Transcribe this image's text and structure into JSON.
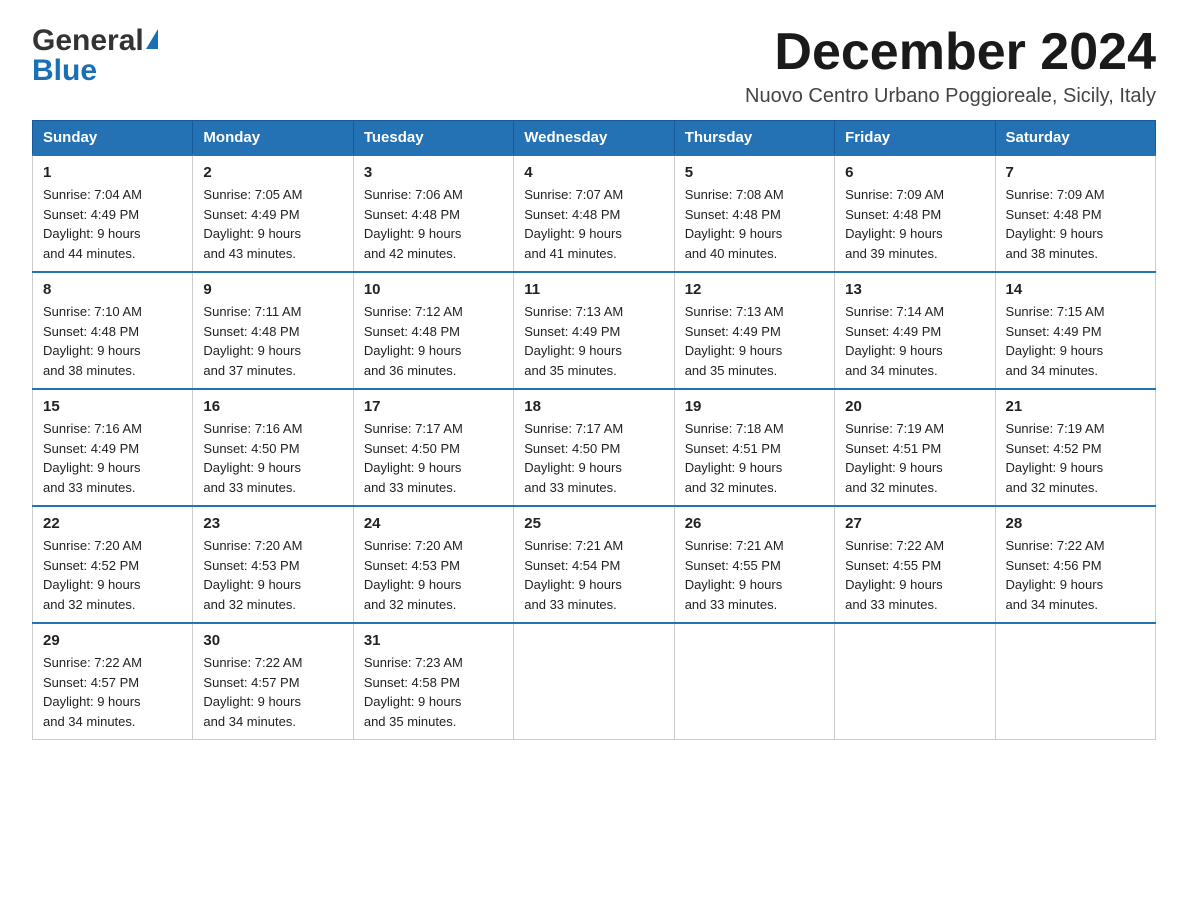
{
  "logo": {
    "general": "General",
    "triangle": "▶",
    "blue": "Blue"
  },
  "header": {
    "month": "December 2024",
    "location": "Nuovo Centro Urbano Poggioreale, Sicily, Italy"
  },
  "days_of_week": [
    "Sunday",
    "Monday",
    "Tuesday",
    "Wednesday",
    "Thursday",
    "Friday",
    "Saturday"
  ],
  "weeks": [
    [
      {
        "day": "1",
        "sunrise": "7:04 AM",
        "sunset": "4:49 PM",
        "daylight": "9 hours and 44 minutes."
      },
      {
        "day": "2",
        "sunrise": "7:05 AM",
        "sunset": "4:49 PM",
        "daylight": "9 hours and 43 minutes."
      },
      {
        "day": "3",
        "sunrise": "7:06 AM",
        "sunset": "4:48 PM",
        "daylight": "9 hours and 42 minutes."
      },
      {
        "day": "4",
        "sunrise": "7:07 AM",
        "sunset": "4:48 PM",
        "daylight": "9 hours and 41 minutes."
      },
      {
        "day": "5",
        "sunrise": "7:08 AM",
        "sunset": "4:48 PM",
        "daylight": "9 hours and 40 minutes."
      },
      {
        "day": "6",
        "sunrise": "7:09 AM",
        "sunset": "4:48 PM",
        "daylight": "9 hours and 39 minutes."
      },
      {
        "day": "7",
        "sunrise": "7:09 AM",
        "sunset": "4:48 PM",
        "daylight": "9 hours and 38 minutes."
      }
    ],
    [
      {
        "day": "8",
        "sunrise": "7:10 AM",
        "sunset": "4:48 PM",
        "daylight": "9 hours and 38 minutes."
      },
      {
        "day": "9",
        "sunrise": "7:11 AM",
        "sunset": "4:48 PM",
        "daylight": "9 hours and 37 minutes."
      },
      {
        "day": "10",
        "sunrise": "7:12 AM",
        "sunset": "4:48 PM",
        "daylight": "9 hours and 36 minutes."
      },
      {
        "day": "11",
        "sunrise": "7:13 AM",
        "sunset": "4:49 PM",
        "daylight": "9 hours and 35 minutes."
      },
      {
        "day": "12",
        "sunrise": "7:13 AM",
        "sunset": "4:49 PM",
        "daylight": "9 hours and 35 minutes."
      },
      {
        "day": "13",
        "sunrise": "7:14 AM",
        "sunset": "4:49 PM",
        "daylight": "9 hours and 34 minutes."
      },
      {
        "day": "14",
        "sunrise": "7:15 AM",
        "sunset": "4:49 PM",
        "daylight": "9 hours and 34 minutes."
      }
    ],
    [
      {
        "day": "15",
        "sunrise": "7:16 AM",
        "sunset": "4:49 PM",
        "daylight": "9 hours and 33 minutes."
      },
      {
        "day": "16",
        "sunrise": "7:16 AM",
        "sunset": "4:50 PM",
        "daylight": "9 hours and 33 minutes."
      },
      {
        "day": "17",
        "sunrise": "7:17 AM",
        "sunset": "4:50 PM",
        "daylight": "9 hours and 33 minutes."
      },
      {
        "day": "18",
        "sunrise": "7:17 AM",
        "sunset": "4:50 PM",
        "daylight": "9 hours and 33 minutes."
      },
      {
        "day": "19",
        "sunrise": "7:18 AM",
        "sunset": "4:51 PM",
        "daylight": "9 hours and 32 minutes."
      },
      {
        "day": "20",
        "sunrise": "7:19 AM",
        "sunset": "4:51 PM",
        "daylight": "9 hours and 32 minutes."
      },
      {
        "day": "21",
        "sunrise": "7:19 AM",
        "sunset": "4:52 PM",
        "daylight": "9 hours and 32 minutes."
      }
    ],
    [
      {
        "day": "22",
        "sunrise": "7:20 AM",
        "sunset": "4:52 PM",
        "daylight": "9 hours and 32 minutes."
      },
      {
        "day": "23",
        "sunrise": "7:20 AM",
        "sunset": "4:53 PM",
        "daylight": "9 hours and 32 minutes."
      },
      {
        "day": "24",
        "sunrise": "7:20 AM",
        "sunset": "4:53 PM",
        "daylight": "9 hours and 32 minutes."
      },
      {
        "day": "25",
        "sunrise": "7:21 AM",
        "sunset": "4:54 PM",
        "daylight": "9 hours and 33 minutes."
      },
      {
        "day": "26",
        "sunrise": "7:21 AM",
        "sunset": "4:55 PM",
        "daylight": "9 hours and 33 minutes."
      },
      {
        "day": "27",
        "sunrise": "7:22 AM",
        "sunset": "4:55 PM",
        "daylight": "9 hours and 33 minutes."
      },
      {
        "day": "28",
        "sunrise": "7:22 AM",
        "sunset": "4:56 PM",
        "daylight": "9 hours and 34 minutes."
      }
    ],
    [
      {
        "day": "29",
        "sunrise": "7:22 AM",
        "sunset": "4:57 PM",
        "daylight": "9 hours and 34 minutes."
      },
      {
        "day": "30",
        "sunrise": "7:22 AM",
        "sunset": "4:57 PM",
        "daylight": "9 hours and 34 minutes."
      },
      {
        "day": "31",
        "sunrise": "7:23 AM",
        "sunset": "4:58 PM",
        "daylight": "9 hours and 35 minutes."
      },
      null,
      null,
      null,
      null
    ]
  ]
}
